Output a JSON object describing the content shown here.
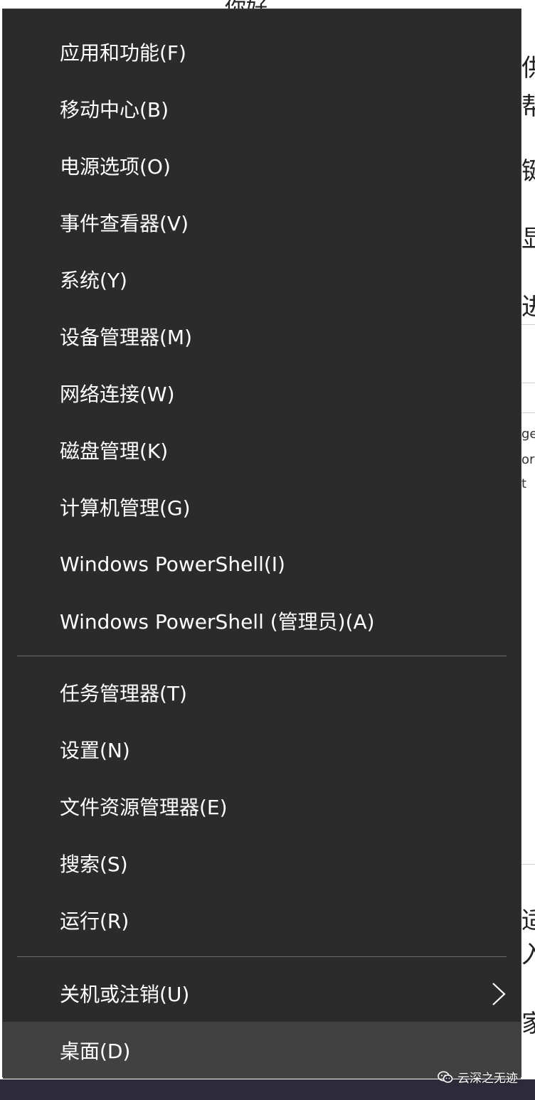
{
  "menu": {
    "group1": [
      {
        "label": "应用和功能(F)"
      },
      {
        "label": "移动中心(B)"
      },
      {
        "label": "电源选项(O)"
      },
      {
        "label": "事件查看器(V)"
      },
      {
        "label": "系统(Y)"
      },
      {
        "label": "设备管理器(M)"
      },
      {
        "label": "网络连接(W)"
      },
      {
        "label": "磁盘管理(K)"
      },
      {
        "label": "计算机管理(G)"
      },
      {
        "label": "Windows PowerShell(I)"
      },
      {
        "label": "Windows PowerShell (管理员)(A)"
      }
    ],
    "group2": [
      {
        "label": "任务管理器(T)"
      },
      {
        "label": "设置(N)"
      },
      {
        "label": "文件资源管理器(E)"
      },
      {
        "label": "搜索(S)"
      },
      {
        "label": "运行(R)"
      }
    ],
    "group3": [
      {
        "label": "关机或注销(U)",
        "submenu_icon": "chevron-right-icon"
      },
      {
        "label": "桌面(D)",
        "state": "hovered"
      }
    ]
  },
  "background": {
    "top_text": "你好",
    "side_glyphs": [
      "供",
      "帮",
      "键",
      "显",
      "进",
      "ge",
      "or",
      "t",
      "适",
      "入",
      "家"
    ]
  },
  "watermark": {
    "icon": "wechat-icon",
    "text": "云深之无迹"
  },
  "colors": {
    "menu_bg": "#2b2b2b",
    "hover_bg": "#414141",
    "separator": "#6a6a6a",
    "text": "#ffffff",
    "taskbar": "#2d2b39"
  }
}
